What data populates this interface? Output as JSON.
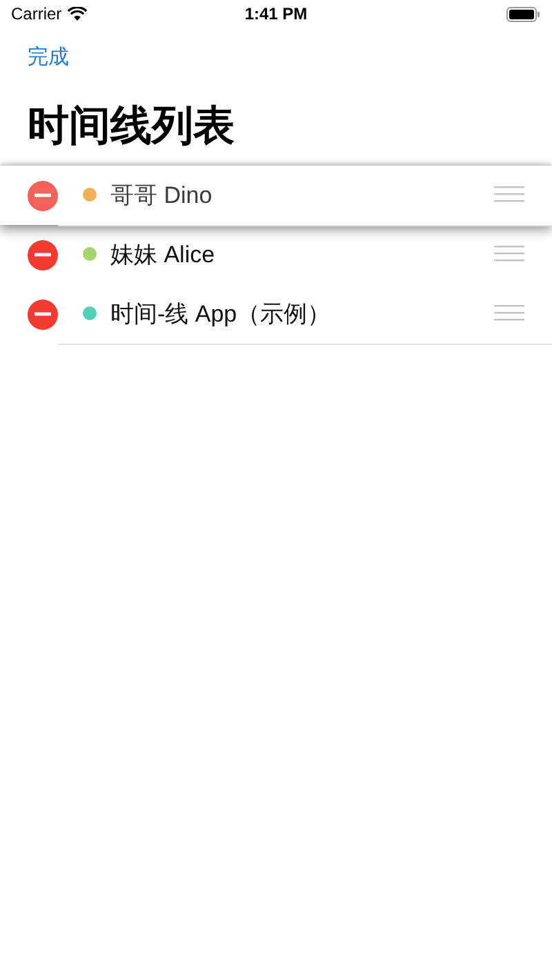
{
  "status_bar": {
    "carrier": "Carrier",
    "time": "1:41 PM"
  },
  "nav": {
    "done_label": "完成"
  },
  "title": "时间线列表",
  "rows": [
    {
      "label": "哥哥 Dino",
      "color": "#f0b057",
      "dragging": true
    },
    {
      "label": "妹妹 Alice",
      "color": "#a5d46e",
      "dragging": false
    },
    {
      "label": "时间-线 App（示例）",
      "color": "#4fd1b5",
      "dragging": false
    }
  ]
}
